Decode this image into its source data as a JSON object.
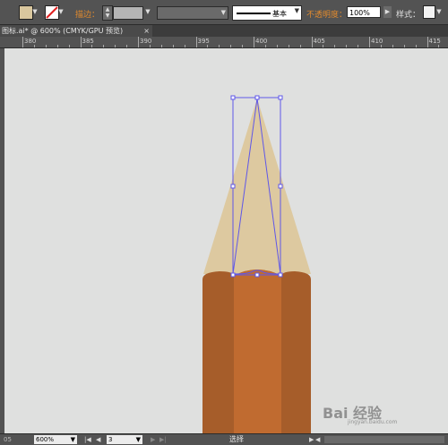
{
  "control_bar": {
    "fill_color": "#d9c79e",
    "stroke_label": "描边：",
    "brush_name": "基本",
    "opacity_label": "不透明度：",
    "opacity_value": "100%",
    "style_label": "样式：",
    "label_accent_color": "#e08a2e"
  },
  "document": {
    "tab_title": "图标.ai* @ 600% (CMYK/GPU 预览)",
    "close_label": "×"
  },
  "ruler": {
    "ticks": [
      "380",
      "385",
      "390",
      "395",
      "400",
      "405",
      "410",
      "415"
    ]
  },
  "artwork": {
    "canvas_color": "#dfe0df",
    "cone_color": "#ddc9a0",
    "body_color": "#c06b30",
    "body_shadow_color": "#a65d2a",
    "selection_color": "#5f57e8"
  },
  "status_bar": {
    "zoom": "600%",
    "page": "3",
    "tool": "选择",
    "left_indicator": "05"
  },
  "watermark": {
    "text": "Bai 经验",
    "sub": "jingyan.baidu.com"
  }
}
